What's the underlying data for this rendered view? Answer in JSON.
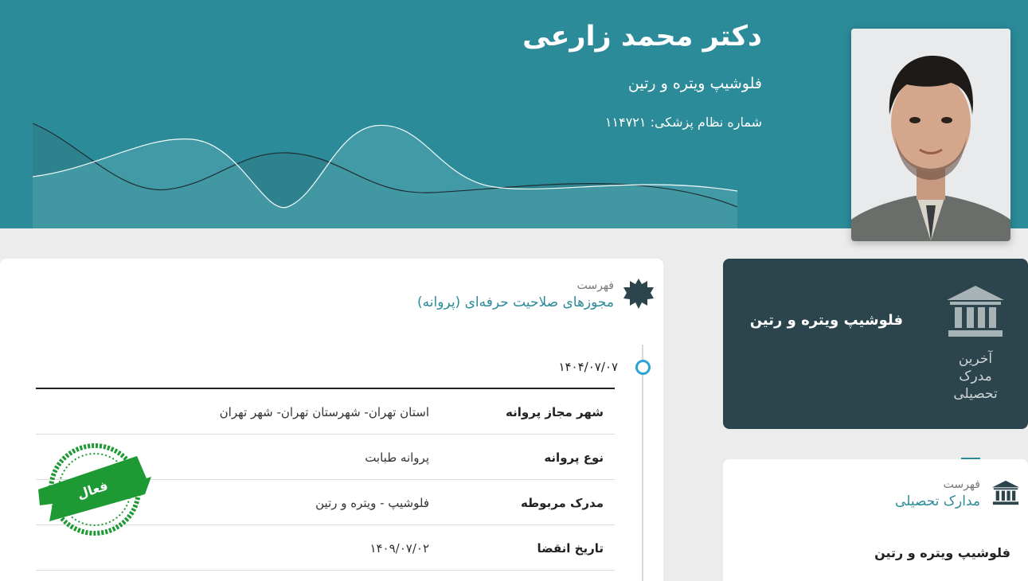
{
  "doctor": {
    "name": "دکتر محمد زارعی",
    "specialty": "فلوشیپ ویتره و رتین",
    "license_label": "شماره نظام پزشکی:",
    "license_number": "۱۱۴۷۲۱"
  },
  "colors": {
    "header": "#2b8b99",
    "dark_card": "#2c444c",
    "accent": "#2b8b99",
    "timeline_dot": "#2aa5d4",
    "stamp_green": "#1e9a34"
  },
  "licenses": {
    "kicker": "فهرست",
    "title": "مجوزهای صلاحیت حرفه‌ای (پروانه)",
    "icon": "badge-icon",
    "date": "۱۴۰۴/۰۷/۰۷",
    "rows": [
      {
        "key": "شهر مجاز پروانه",
        "value": "استان تهران- شهرستان تهران- شهر تهران"
      },
      {
        "key": "نوع پروانه",
        "value": "پروانه طبابت"
      },
      {
        "key": "مدرک مربوطه",
        "value": "فلوشیپ - ویتره و رتین"
      },
      {
        "key": "تاریخ انقضا",
        "value": "۱۴۰۹/۰۷/۰۲"
      }
    ],
    "stamp_text": "فعال"
  },
  "latest_degree": {
    "title": "فلوشیپ ویتره و رتین",
    "label_line1": "آخرین",
    "label_line2": "مدرک",
    "label_line3": "تحصیلی",
    "icon": "institution-icon"
  },
  "degrees": {
    "kicker": "فهرست",
    "title": "مدارک تحصیلی",
    "icon": "institution-icon",
    "items": [
      "فلوشیپ ویتره و رتین"
    ]
  }
}
